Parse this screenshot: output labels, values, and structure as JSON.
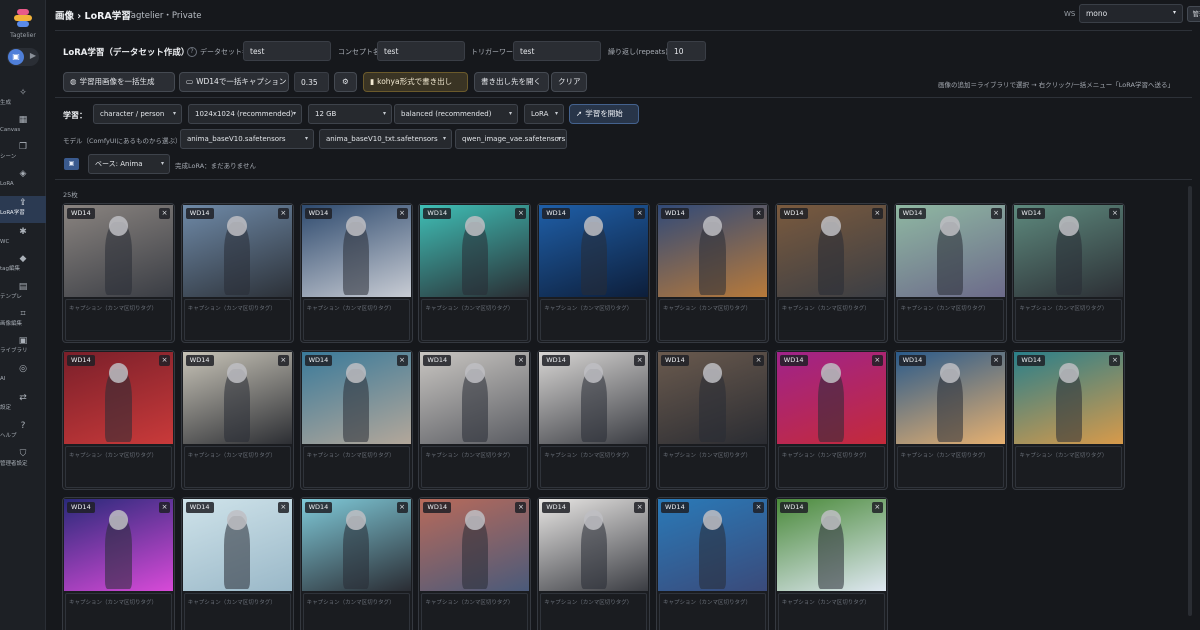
{
  "app": {
    "brand": "Tagtelier"
  },
  "header": {
    "breadcrumb": "画像 › LoRA学習",
    "subtitle": "Tagtelier・Private",
    "ws_label": "WS",
    "ws_value": "mono",
    "admin_label": "管理"
  },
  "sidebar": {
    "items": [
      {
        "label": "生成",
        "icon": "sparkle-icon"
      },
      {
        "label": "Canvas",
        "icon": "grid-icon"
      },
      {
        "label": "シーン",
        "icon": "copy-icon"
      },
      {
        "label": "LoRA",
        "icon": "layers-icon"
      },
      {
        "label": "LoRA学習",
        "icon": "upload-icon"
      },
      {
        "label": "WC",
        "icon": "asterisk-icon"
      },
      {
        "label": "tag編集",
        "icon": "tag-icon"
      },
      {
        "label": "テンプレ",
        "icon": "template-icon"
      },
      {
        "label": "画像編集",
        "icon": "crop-icon"
      },
      {
        "label": "ライブラリ",
        "icon": "image-icon"
      },
      {
        "label": "AI",
        "icon": "ai-icon"
      },
      {
        "label": "設定",
        "icon": "settings-icon"
      },
      {
        "label": "ヘルプ",
        "icon": "help-icon"
      },
      {
        "label": "管理者設定",
        "icon": "shield-icon"
      }
    ]
  },
  "dataset": {
    "section_title": "LoRA学習（データセット作成）",
    "help_glyph": "?",
    "dataset_label": "データセット名",
    "dataset_value": "test",
    "concept_label": "コンセプト名",
    "concept_value": "test",
    "trigger_label": "トリガーワード",
    "trigger_value": "test",
    "repeats_label": "繰り返し(repeats)",
    "repeats_value": "10"
  },
  "actions": {
    "bulk_create": "学習用画像を一括生成",
    "wd14_caption": "WD14で一括キャプション",
    "threshold": "0.35",
    "gear_glyph": "⚙",
    "kohya_export": "kohya形式で書き出し",
    "open_export": "書き出し先を開く",
    "clear": "クリア",
    "hint": "画像の追加＝ライブラリで選択 → 右クリック/一括メニュー「LoRA学習へ送る」"
  },
  "training": {
    "label": "学習：",
    "type": "character / person",
    "resolution": "1024x1024 (recommended)",
    "vram": "12 GB",
    "preset": "balanced (recommended)",
    "kind": "LoRA",
    "start": "学習を開始",
    "model_label": "モデル（ComfyUIにあるものから選ぶ）:",
    "model_main": "anima_baseV10.safetensors",
    "model_txt": "anima_baseV10_txt.safetensors",
    "model_vae": "qwen_image_vae.safetensors",
    "base_label": "ベース: Anima",
    "done_status": "完成LoRA：まだありません"
  },
  "gallery": {
    "count": "25枚",
    "tag_label": "WD14",
    "close_glyph": "×",
    "caption_placeholder": "キャプション（カンマ区切りタグ）",
    "items": [
      {
        "bg": "#8a8480",
        "accent": "#3a3d44"
      },
      {
        "bg": "#6f8aa8",
        "accent": "#2c3138"
      },
      {
        "bg": "#2e4a6e",
        "accent": "#c8ccd4"
      },
      {
        "bg": "#3fbfb6",
        "accent": "#2a2d33"
      },
      {
        "bg": "#1f5fa8",
        "accent": "#0d1e3a"
      },
      {
        "bg": "#314a78",
        "accent": "#b87a3a"
      },
      {
        "bg": "#7a5a3e",
        "accent": "#3b3e44"
      },
      {
        "bg": "#8fb8a2",
        "accent": "#6c6a8a"
      },
      {
        "bg": "#5e8a7e",
        "accent": "#2c2f35"
      },
      {
        "bg": "#7a1f2a",
        "accent": "#c93a3a"
      },
      {
        "bg": "#c8c4b8",
        "accent": "#2c2e33"
      },
      {
        "bg": "#3a7a9a",
        "accent": "#b3a79a"
      },
      {
        "bg": "#c9c6c2",
        "accent": "#5a5c62"
      },
      {
        "bg": "#d8d6d4",
        "accent": "#3a3c42"
      },
      {
        "bg": "#6a5a4e",
        "accent": "#2a2c32"
      },
      {
        "bg": "#a0238a",
        "accent": "#c42a3a"
      },
      {
        "bg": "#2a5a8a",
        "accent": "#e6b070"
      },
      {
        "bg": "#2a7f8a",
        "accent": "#d89a4a"
      },
      {
        "bg": "#2a2a7a",
        "accent": "#d84ad8"
      },
      {
        "bg": "#cfe3ea",
        "accent": "#9ab8c8"
      },
      {
        "bg": "#7fc9d8",
        "accent": "#2a2c33"
      },
      {
        "bg": "#b86a5a",
        "accent": "#4a5a7a"
      },
      {
        "bg": "#e8e6e4",
        "accent": "#3a3c42"
      },
      {
        "bg": "#2a7ab8",
        "accent": "#3a4a7a"
      },
      {
        "bg": "#4a8a3a",
        "accent": "#dfe8f2"
      }
    ]
  },
  "colors": {
    "accent_blue": "#4f7fd9",
    "logo": [
      "#e85a8a",
      "#f2b23a",
      "#5a8ae8"
    ]
  }
}
